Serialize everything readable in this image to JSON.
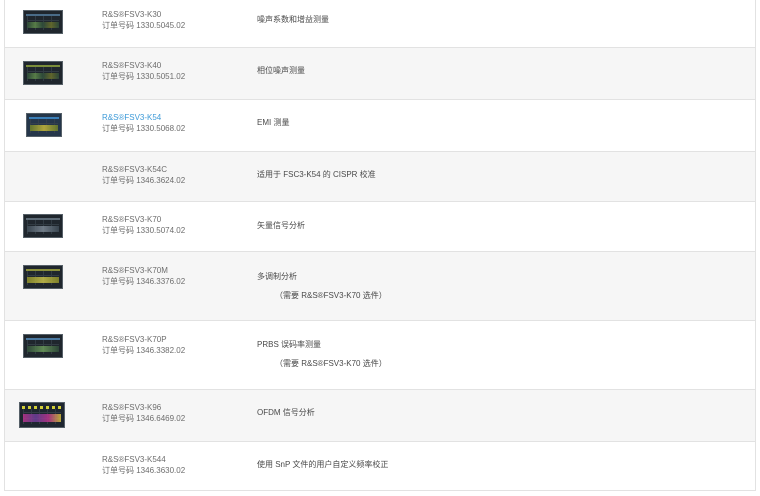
{
  "rows": [
    {
      "name": "R&S®FSV3-K30",
      "order": "订单号码 1330.5045.02",
      "desc": "噪声系数和增益测量",
      "note": ""
    },
    {
      "name": "R&S®FSV3-K40",
      "order": "订单号码 1330.5051.02",
      "desc": "相位噪声测量",
      "note": ""
    },
    {
      "name": "R&S®FSV3-K54",
      "order": "订单号码 1330.5068.02",
      "desc": "EMI 测量",
      "note": ""
    },
    {
      "name": "R&S®FSV3-K54C",
      "order": "订单号码 1346.3624.02",
      "desc": "适用于 FSC3-K54 的 CISPR 校准",
      "note": ""
    },
    {
      "name": "R&S®FSV3-K70",
      "order": "订单号码 1330.5074.02",
      "desc": "矢量信号分析",
      "note": ""
    },
    {
      "name": "R&S®FSV3-K70M",
      "order": "订单号码 1346.3376.02",
      "desc": "多调制分析",
      "note": "（需要 R&S®FSV3-K70 选件）"
    },
    {
      "name": "R&S®FSV3-K70P",
      "order": "订单号码 1346.3382.02",
      "desc": "PRBS 误码率测量",
      "note": "（需要 R&S®FSV3-K70 选件）"
    },
    {
      "name": "R&S®FSV3-K96",
      "order": "订单号码 1346.6469.02",
      "desc": "OFDM 信号分析",
      "note": ""
    },
    {
      "name": "R&S®FSV3-K544",
      "order": "订单号码 1346.3630.02",
      "desc": "使用 SnP 文件的用户自定义频率校正",
      "note": ""
    }
  ]
}
